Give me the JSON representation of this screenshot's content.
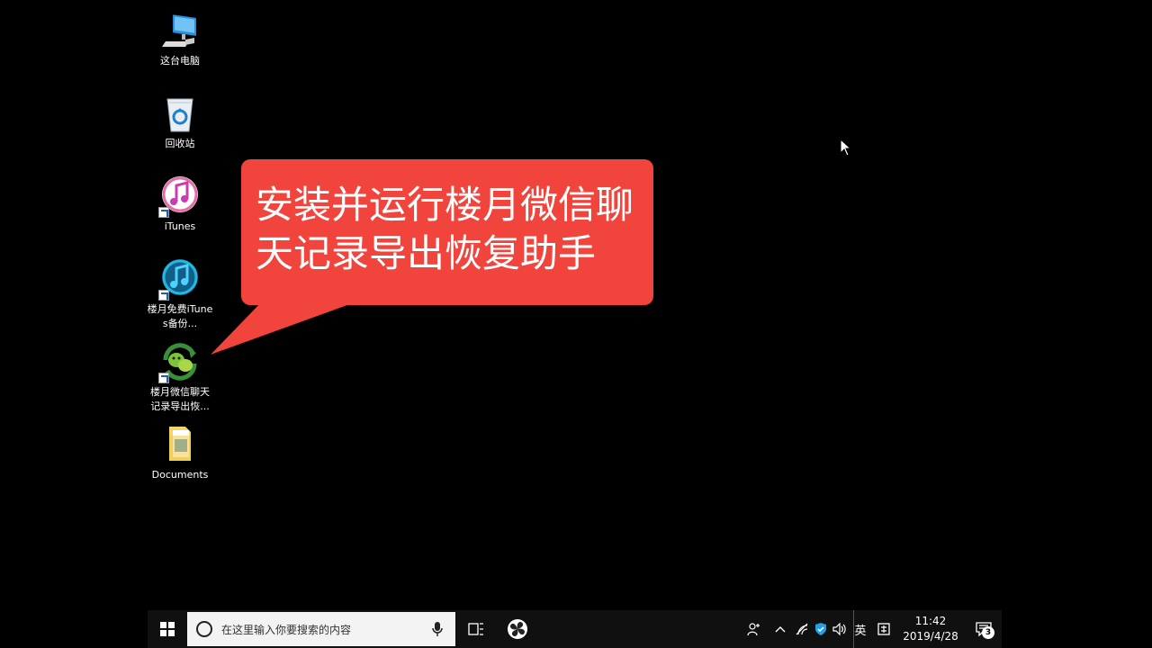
{
  "desktop": {
    "icons": [
      {
        "label": "这台电脑",
        "icon": "computer-icon"
      },
      {
        "label": "回收站",
        "icon": "recycle-bin-icon"
      },
      {
        "label": "iTunes",
        "icon": "itunes-icon"
      },
      {
        "label": "楼月免费iTunes备份...",
        "icon": "itunes-backup-icon"
      },
      {
        "label": "楼月微信聊天记录导出恢...",
        "icon": "wechat-recovery-icon"
      },
      {
        "label": "Documents",
        "icon": "folder-icon"
      }
    ]
  },
  "callout": {
    "text": "安装并运行楼月微信聊天记录导出恢复助手",
    "color": "#f0443c"
  },
  "taskbar": {
    "search_placeholder": "在这里输入你要搜索的内容",
    "ime_label": "英",
    "time": "11:42",
    "date": "2019/4/28",
    "notification_count": "3"
  },
  "icons": {
    "start": "windows-logo-icon",
    "search": "cortana-circle-icon",
    "mic": "microphone-icon",
    "task_view": "task-view-icon",
    "app": "pinwheel-app-icon",
    "people": "people-icon",
    "chevron": "chevron-up-icon",
    "network": "network-icon",
    "security": "shield-icon",
    "volume": "volume-icon",
    "keyboard": "input-method-icon",
    "notifications": "action-center-icon"
  }
}
